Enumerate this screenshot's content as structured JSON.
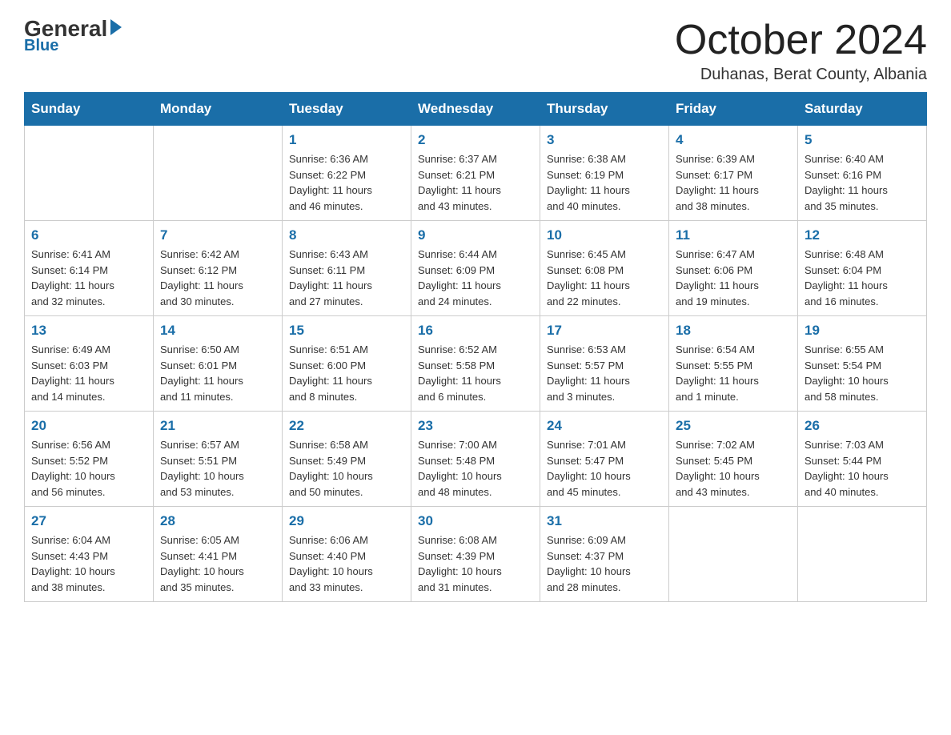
{
  "header": {
    "logo_general": "General",
    "logo_blue": "Blue",
    "month_title": "October 2024",
    "location": "Duhanas, Berat County, Albania"
  },
  "days_of_week": [
    "Sunday",
    "Monday",
    "Tuesday",
    "Wednesday",
    "Thursday",
    "Friday",
    "Saturday"
  ],
  "weeks": [
    [
      {
        "day": "",
        "info": ""
      },
      {
        "day": "",
        "info": ""
      },
      {
        "day": "1",
        "info": "Sunrise: 6:36 AM\nSunset: 6:22 PM\nDaylight: 11 hours\nand 46 minutes."
      },
      {
        "day": "2",
        "info": "Sunrise: 6:37 AM\nSunset: 6:21 PM\nDaylight: 11 hours\nand 43 minutes."
      },
      {
        "day": "3",
        "info": "Sunrise: 6:38 AM\nSunset: 6:19 PM\nDaylight: 11 hours\nand 40 minutes."
      },
      {
        "day": "4",
        "info": "Sunrise: 6:39 AM\nSunset: 6:17 PM\nDaylight: 11 hours\nand 38 minutes."
      },
      {
        "day": "5",
        "info": "Sunrise: 6:40 AM\nSunset: 6:16 PM\nDaylight: 11 hours\nand 35 minutes."
      }
    ],
    [
      {
        "day": "6",
        "info": "Sunrise: 6:41 AM\nSunset: 6:14 PM\nDaylight: 11 hours\nand 32 minutes."
      },
      {
        "day": "7",
        "info": "Sunrise: 6:42 AM\nSunset: 6:12 PM\nDaylight: 11 hours\nand 30 minutes."
      },
      {
        "day": "8",
        "info": "Sunrise: 6:43 AM\nSunset: 6:11 PM\nDaylight: 11 hours\nand 27 minutes."
      },
      {
        "day": "9",
        "info": "Sunrise: 6:44 AM\nSunset: 6:09 PM\nDaylight: 11 hours\nand 24 minutes."
      },
      {
        "day": "10",
        "info": "Sunrise: 6:45 AM\nSunset: 6:08 PM\nDaylight: 11 hours\nand 22 minutes."
      },
      {
        "day": "11",
        "info": "Sunrise: 6:47 AM\nSunset: 6:06 PM\nDaylight: 11 hours\nand 19 minutes."
      },
      {
        "day": "12",
        "info": "Sunrise: 6:48 AM\nSunset: 6:04 PM\nDaylight: 11 hours\nand 16 minutes."
      }
    ],
    [
      {
        "day": "13",
        "info": "Sunrise: 6:49 AM\nSunset: 6:03 PM\nDaylight: 11 hours\nand 14 minutes."
      },
      {
        "day": "14",
        "info": "Sunrise: 6:50 AM\nSunset: 6:01 PM\nDaylight: 11 hours\nand 11 minutes."
      },
      {
        "day": "15",
        "info": "Sunrise: 6:51 AM\nSunset: 6:00 PM\nDaylight: 11 hours\nand 8 minutes."
      },
      {
        "day": "16",
        "info": "Sunrise: 6:52 AM\nSunset: 5:58 PM\nDaylight: 11 hours\nand 6 minutes."
      },
      {
        "day": "17",
        "info": "Sunrise: 6:53 AM\nSunset: 5:57 PM\nDaylight: 11 hours\nand 3 minutes."
      },
      {
        "day": "18",
        "info": "Sunrise: 6:54 AM\nSunset: 5:55 PM\nDaylight: 11 hours\nand 1 minute."
      },
      {
        "day": "19",
        "info": "Sunrise: 6:55 AM\nSunset: 5:54 PM\nDaylight: 10 hours\nand 58 minutes."
      }
    ],
    [
      {
        "day": "20",
        "info": "Sunrise: 6:56 AM\nSunset: 5:52 PM\nDaylight: 10 hours\nand 56 minutes."
      },
      {
        "day": "21",
        "info": "Sunrise: 6:57 AM\nSunset: 5:51 PM\nDaylight: 10 hours\nand 53 minutes."
      },
      {
        "day": "22",
        "info": "Sunrise: 6:58 AM\nSunset: 5:49 PM\nDaylight: 10 hours\nand 50 minutes."
      },
      {
        "day": "23",
        "info": "Sunrise: 7:00 AM\nSunset: 5:48 PM\nDaylight: 10 hours\nand 48 minutes."
      },
      {
        "day": "24",
        "info": "Sunrise: 7:01 AM\nSunset: 5:47 PM\nDaylight: 10 hours\nand 45 minutes."
      },
      {
        "day": "25",
        "info": "Sunrise: 7:02 AM\nSunset: 5:45 PM\nDaylight: 10 hours\nand 43 minutes."
      },
      {
        "day": "26",
        "info": "Sunrise: 7:03 AM\nSunset: 5:44 PM\nDaylight: 10 hours\nand 40 minutes."
      }
    ],
    [
      {
        "day": "27",
        "info": "Sunrise: 6:04 AM\nSunset: 4:43 PM\nDaylight: 10 hours\nand 38 minutes."
      },
      {
        "day": "28",
        "info": "Sunrise: 6:05 AM\nSunset: 4:41 PM\nDaylight: 10 hours\nand 35 minutes."
      },
      {
        "day": "29",
        "info": "Sunrise: 6:06 AM\nSunset: 4:40 PM\nDaylight: 10 hours\nand 33 minutes."
      },
      {
        "day": "30",
        "info": "Sunrise: 6:08 AM\nSunset: 4:39 PM\nDaylight: 10 hours\nand 31 minutes."
      },
      {
        "day": "31",
        "info": "Sunrise: 6:09 AM\nSunset: 4:37 PM\nDaylight: 10 hours\nand 28 minutes."
      },
      {
        "day": "",
        "info": ""
      },
      {
        "day": "",
        "info": ""
      }
    ]
  ]
}
